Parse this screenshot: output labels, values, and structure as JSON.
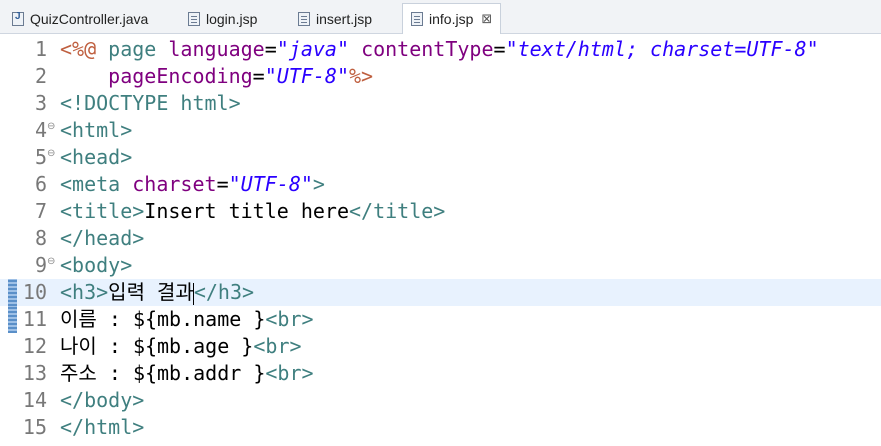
{
  "tabs": [
    {
      "label": "QuizController.java",
      "icon": "java-file-icon",
      "active": false
    },
    {
      "label": "login.jsp",
      "icon": "jsp-file-icon",
      "active": false
    },
    {
      "label": "insert.jsp",
      "icon": "jsp-file-icon",
      "active": false
    },
    {
      "label": "info.jsp",
      "icon": "jsp-file-icon",
      "active": true,
      "close": "⊠"
    }
  ],
  "colors": {
    "tag": "#3f7f7f",
    "attribute": "#7f007f",
    "value": "#2a00ff",
    "directive": "#bf5f3f",
    "current_line": "#e8f2fe",
    "line_number": "#787878"
  },
  "editor": {
    "current_line": 10,
    "lines": [
      {
        "n": "1",
        "fold": "",
        "tokens": [
          {
            "t": "<%@",
            "c": "dir"
          },
          {
            "t": " ",
            "c": "text"
          },
          {
            "t": "page",
            "c": "tag"
          },
          {
            "t": " ",
            "c": "text"
          },
          {
            "t": "language",
            "c": "attr"
          },
          {
            "t": "=",
            "c": "text"
          },
          {
            "t": "\"java\"",
            "c": "val"
          },
          {
            "t": " ",
            "c": "text"
          },
          {
            "t": "contentType",
            "c": "attr"
          },
          {
            "t": "=",
            "c": "text"
          },
          {
            "t": "\"text/html; charset=UTF-8\"",
            "c": "val"
          }
        ]
      },
      {
        "n": "2",
        "fold": "",
        "tokens": [
          {
            "t": "    ",
            "c": "text"
          },
          {
            "t": "pageEncoding",
            "c": "attr"
          },
          {
            "t": "=",
            "c": "text"
          },
          {
            "t": "\"UTF-8\"",
            "c": "val"
          },
          {
            "t": "%>",
            "c": "dir"
          }
        ]
      },
      {
        "n": "3",
        "fold": "",
        "tokens": [
          {
            "t": "<!DOCTYPE html>",
            "c": "tag"
          }
        ]
      },
      {
        "n": "4",
        "fold": "⊖",
        "tokens": [
          {
            "t": "<html>",
            "c": "tag"
          }
        ]
      },
      {
        "n": "5",
        "fold": "⊖",
        "tokens": [
          {
            "t": "<head>",
            "c": "tag"
          }
        ]
      },
      {
        "n": "6",
        "fold": "",
        "tokens": [
          {
            "t": "<meta",
            "c": "tag"
          },
          {
            "t": " ",
            "c": "text"
          },
          {
            "t": "charset",
            "c": "attr"
          },
          {
            "t": "=",
            "c": "text"
          },
          {
            "t": "\"UTF-8\"",
            "c": "val"
          },
          {
            "t": ">",
            "c": "tag"
          }
        ]
      },
      {
        "n": "7",
        "fold": "",
        "tokens": [
          {
            "t": "<title>",
            "c": "tag"
          },
          {
            "t": "Insert title here",
            "c": "text"
          },
          {
            "t": "</title>",
            "c": "tag"
          }
        ]
      },
      {
        "n": "8",
        "fold": "",
        "tokens": [
          {
            "t": "</head>",
            "c": "tag"
          }
        ]
      },
      {
        "n": "9",
        "fold": "⊖",
        "tokens": [
          {
            "t": "<body>",
            "c": "tag"
          }
        ]
      },
      {
        "n": "10",
        "fold": "",
        "tokens": [
          {
            "t": "<h3>",
            "c": "tag"
          },
          {
            "t": "입력 결과",
            "c": "text"
          },
          {
            "t": "",
            "c": "caret"
          },
          {
            "t": "</h3>",
            "c": "tag"
          }
        ]
      },
      {
        "n": "11",
        "fold": "",
        "tokens": [
          {
            "t": "이름 : ",
            "c": "text"
          },
          {
            "t": "${mb.name }",
            "c": "el"
          },
          {
            "t": "<br>",
            "c": "tag"
          }
        ]
      },
      {
        "n": "12",
        "fold": "",
        "tokens": [
          {
            "t": "나이 : ",
            "c": "text"
          },
          {
            "t": "${mb.age }",
            "c": "el"
          },
          {
            "t": "<br>",
            "c": "tag"
          }
        ]
      },
      {
        "n": "13",
        "fold": "",
        "tokens": [
          {
            "t": "주소 : ",
            "c": "text"
          },
          {
            "t": "${mb.addr }",
            "c": "el"
          },
          {
            "t": "<br>",
            "c": "tag"
          }
        ]
      },
      {
        "n": "14",
        "fold": "",
        "tokens": [
          {
            "t": "</body>",
            "c": "tag"
          }
        ]
      },
      {
        "n": "15",
        "fold": "",
        "tokens": [
          {
            "t": "</html>",
            "c": "tag"
          }
        ]
      }
    ]
  }
}
